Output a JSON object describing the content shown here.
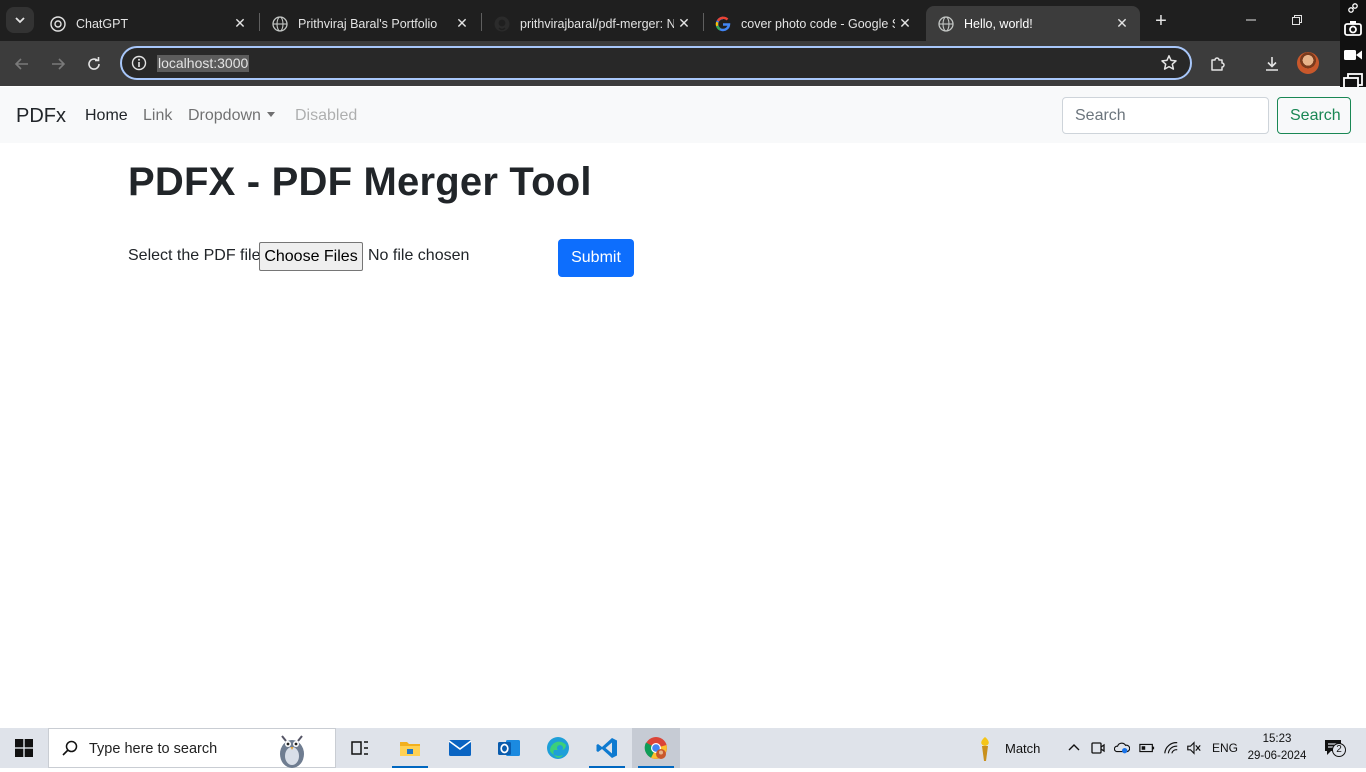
{
  "browser": {
    "tabs": [
      {
        "title": "ChatGPT",
        "icon": "chatgpt-icon",
        "active": false
      },
      {
        "title": "Prithviraj Baral's Portfolio",
        "icon": "globe-icon",
        "active": false
      },
      {
        "title": "prithvirajbaral/pdf-merger: N",
        "icon": "github-icon",
        "active": false
      },
      {
        "title": "cover photo code - Google S",
        "icon": "google-icon",
        "active": false
      },
      {
        "title": "Hello, world!",
        "icon": "globe-icon",
        "active": true
      }
    ],
    "url": "localhost:3000"
  },
  "navbar": {
    "brand": "PDFx",
    "links": [
      {
        "label": "Home",
        "state": "active"
      },
      {
        "label": "Link",
        "state": "normal"
      },
      {
        "label": "Dropdown",
        "state": "normal"
      },
      {
        "label": "Disabled",
        "state": "disabled"
      }
    ],
    "search_placeholder": "Search",
    "search_button": "Search"
  },
  "main": {
    "title": "PDFX - PDF Merger Tool",
    "file_label": "Select the PDF file",
    "choose_button": "Choose Files",
    "file_status": "No file chosen",
    "submit_button": "Submit"
  },
  "taskbar": {
    "search_placeholder": "Type here to search",
    "weather_text": "Match",
    "language": "ENG",
    "time": "15:23",
    "date": "29-06-2024",
    "notification_count": "2"
  },
  "colors": {
    "primary": "#0d6efd",
    "success": "#198754",
    "chrome_dark": "#1f1f1f"
  }
}
